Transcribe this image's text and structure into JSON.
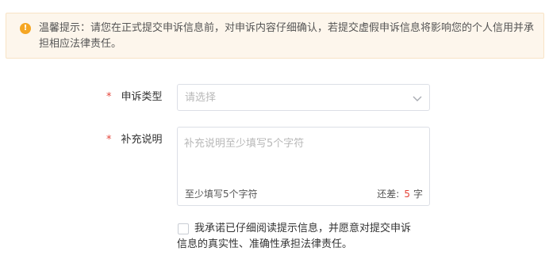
{
  "notice": {
    "icon": "exclamation-icon",
    "text": "温馨提示：请您在正式提交申诉信息前，对申诉内容仔细确认，若提交虚假申诉信息将影响您的个人信用并承担相应法律责任。"
  },
  "form": {
    "appeal_type": {
      "required_mark": "*",
      "label": "申诉类型",
      "placeholder": "请选择",
      "icon": "chevron-down-icon"
    },
    "description": {
      "required_mark": "*",
      "label": "补充说明",
      "placeholder": "补充说明至少填写5个字符",
      "min_hint": "至少填写5个字符",
      "remaining_label": "还差:",
      "remaining_count": "5",
      "remaining_unit": "字"
    },
    "agreement": {
      "checked": false,
      "text": "我承诺已仔细阅读提示信息，并愿意对提交申诉信息的真实性、准确性承担法律责任。"
    }
  },
  "colors": {
    "notice_bg": "#fdf6ec",
    "notice_icon": "#f5a623",
    "required": "#e5453a",
    "placeholder": "#b8b8b8",
    "border": "#dcdfe6"
  }
}
